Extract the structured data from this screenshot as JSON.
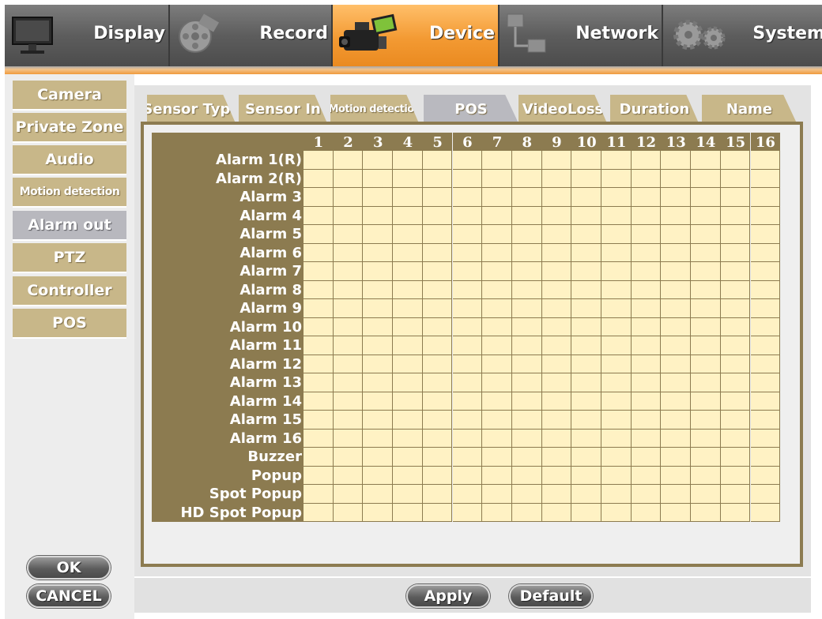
{
  "top_menu": [
    {
      "label": "Display",
      "icon": "monitor-icon",
      "active": false
    },
    {
      "label": "Record",
      "icon": "film-reel-icon",
      "active": false
    },
    {
      "label": "Device",
      "icon": "camcorder-icon",
      "active": true
    },
    {
      "label": "Network",
      "icon": "network-icon",
      "active": false
    },
    {
      "label": "System",
      "icon": "gears-icon",
      "active": false
    }
  ],
  "side_nav": [
    {
      "label": "Camera",
      "active": false
    },
    {
      "label": "Private Zone",
      "active": false
    },
    {
      "label": "Audio",
      "active": false
    },
    {
      "label": "Motion detection",
      "active": false
    },
    {
      "label": "Alarm out",
      "active": true
    },
    {
      "label": "PTZ",
      "active": false
    },
    {
      "label": "Controller",
      "active": false
    },
    {
      "label": "POS",
      "active": false
    }
  ],
  "tabs": [
    {
      "label": "Sensor Type",
      "active": false
    },
    {
      "label": "Sensor In",
      "active": false
    },
    {
      "label": "Motion detection",
      "active": false
    },
    {
      "label": "POS",
      "active": true
    },
    {
      "label": "VideoLoss",
      "active": false
    },
    {
      "label": "Duration",
      "active": false
    },
    {
      "label": "Name",
      "active": false
    }
  ],
  "grid": {
    "columns": [
      "1",
      "2",
      "3",
      "4",
      "5",
      "6",
      "7",
      "8",
      "9",
      "10",
      "11",
      "12",
      "13",
      "14",
      "15",
      "16"
    ],
    "rows": [
      "Alarm 1(R)",
      "Alarm 2(R)",
      "Alarm 3",
      "Alarm 4",
      "Alarm 5",
      "Alarm 6",
      "Alarm 7",
      "Alarm 8",
      "Alarm 9",
      "Alarm 10",
      "Alarm 11",
      "Alarm 12",
      "Alarm 13",
      "Alarm 14",
      "Alarm 15",
      "Alarm 16",
      "Buzzer",
      "Popup",
      "Spot Popup",
      "HD Spot Popup"
    ],
    "checked": []
  },
  "buttons": {
    "ok": "OK",
    "cancel": "CANCEL",
    "apply": "Apply",
    "default": "Default"
  },
  "colors": {
    "accent": "#f39a33",
    "tab_bg": "#c8b789",
    "grid_header": "#8c7b50",
    "cell": "#fff2c4"
  }
}
